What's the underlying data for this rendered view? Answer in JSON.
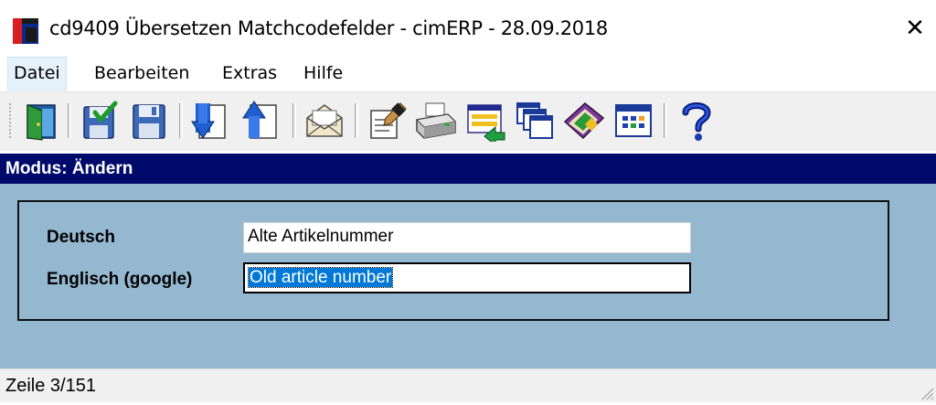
{
  "window": {
    "title": "cd9409 Übersetzen Matchcodefelder - cimERP - 28.09.2018",
    "close_glyph": "✕"
  },
  "menu": {
    "items": [
      {
        "label": "Datei",
        "active": true
      },
      {
        "label": "Bearbeiten",
        "active": false
      },
      {
        "label": "Extras",
        "active": false
      },
      {
        "label": "Hilfe",
        "active": false
      }
    ]
  },
  "toolbar": {
    "buttons": [
      {
        "icon": "exit-door-icon"
      },
      {
        "icon": "save-confirm-icon"
      },
      {
        "icon": "save-icon"
      },
      {
        "icon": "next-record-icon"
      },
      {
        "icon": "previous-record-icon"
      },
      {
        "icon": "mail-icon"
      },
      {
        "icon": "edit-note-icon"
      },
      {
        "icon": "print-icon"
      },
      {
        "icon": "transfer-list-icon"
      },
      {
        "icon": "windows-cascade-icon"
      },
      {
        "icon": "bookmark-book-icon"
      },
      {
        "icon": "calendar-grid-icon"
      },
      {
        "icon": "help-icon"
      }
    ]
  },
  "mode": {
    "label": "Modus: Ändern"
  },
  "form": {
    "german_label": "Deutsch",
    "german_value": "Alte Artikelnummer",
    "english_label": "Englisch (google)",
    "english_value": "Old article number"
  },
  "status": {
    "text": "Zeile 3/151"
  },
  "colors": {
    "mode_bar": "#000a6a",
    "client_bg": "#94b8d0",
    "selection": "#0078d7"
  }
}
